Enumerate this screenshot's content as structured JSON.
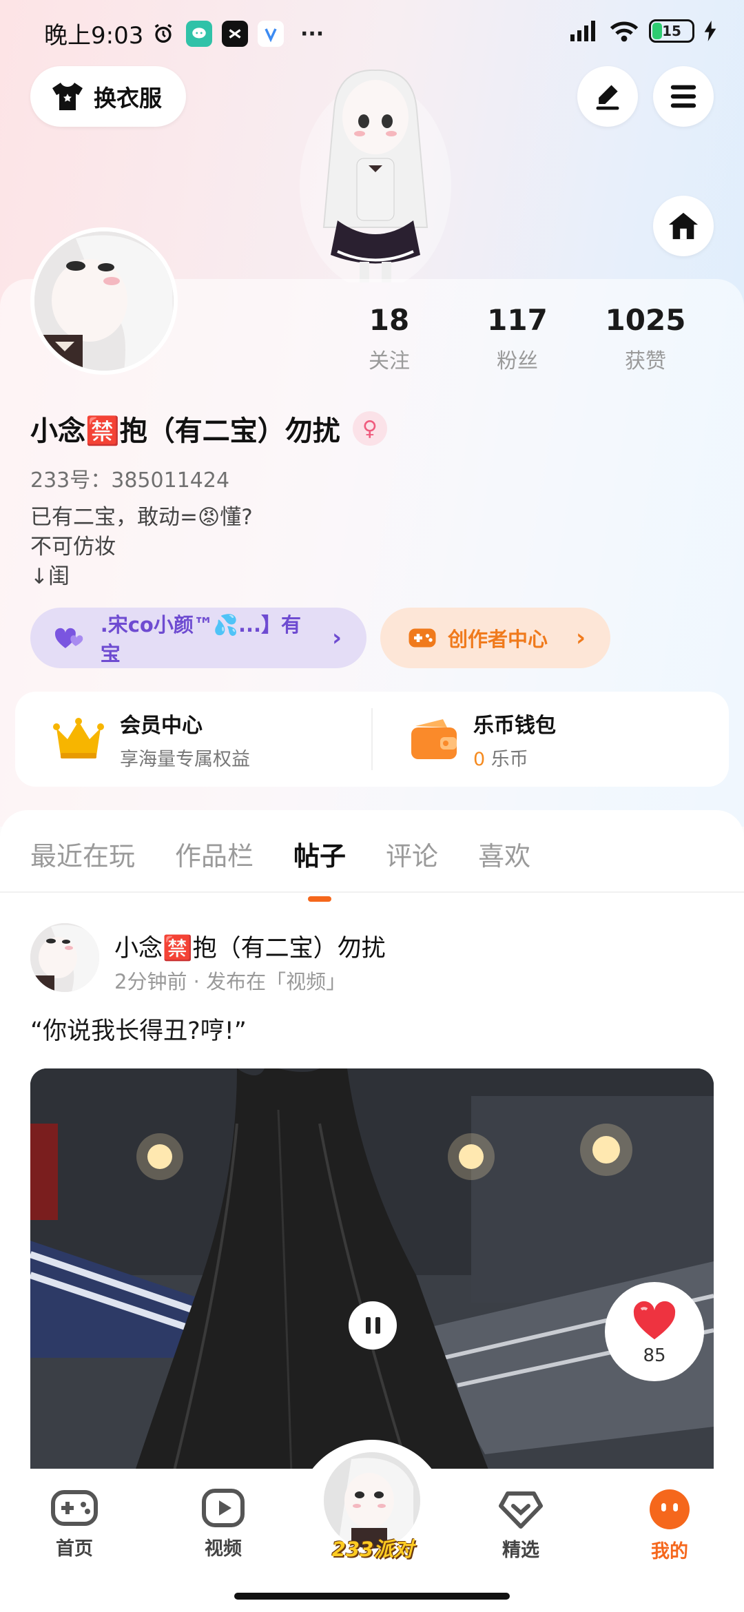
{
  "status_bar": {
    "time": "晚上9:03",
    "battery": "15",
    "more": "···"
  },
  "header": {
    "wardrobe_label": "换衣服"
  },
  "profile": {
    "stats": [
      {
        "value": "18",
        "label": "关注"
      },
      {
        "value": "117",
        "label": "粉丝"
      },
      {
        "value": "1025",
        "label": "获赞"
      }
    ],
    "nickname": "小念🈲抱（有二宝）勿扰",
    "gender_symbol": "♀",
    "uid": "233号：385011424",
    "bio": "已有二宝，敢动=😡懂?\n不可仿妆\n↓闺",
    "partner_pill": ".宋co小颜™💦...】有宝",
    "creator_pill": "创作者中心"
  },
  "member_card": {
    "vip_title": "会员中心",
    "vip_sub": "享海量专属权益",
    "wallet_title": "乐币钱包",
    "wallet_amount": "0",
    "wallet_unit": " 乐币"
  },
  "tabs": [
    "最近在玩",
    "作品栏",
    "帖子",
    "评论",
    "喜欢"
  ],
  "active_tab": "帖子",
  "post": {
    "author": "小念🈲抱（有二宝）勿扰",
    "meta": "2分钟前 · 发布在「视频」",
    "text": "“你说我长得丑?哼!”",
    "likes": "85"
  },
  "bottom_nav": {
    "items": [
      "首页",
      "视频",
      "精选",
      "我的"
    ],
    "center_label": "233派对",
    "active": "我的"
  },
  "colors": {
    "accent": "#f5671c",
    "purple": "#6e4bd1",
    "creator_orange": "#f07a1c"
  }
}
